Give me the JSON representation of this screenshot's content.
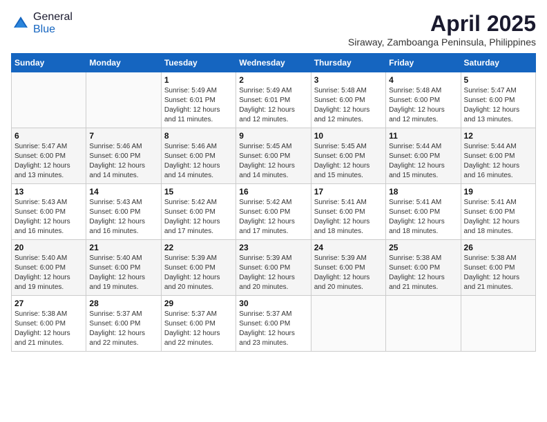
{
  "header": {
    "logo_general": "General",
    "logo_blue": "Blue",
    "title": "April 2025",
    "subtitle": "Siraway, Zamboanga Peninsula, Philippines"
  },
  "calendar": {
    "columns": [
      "Sunday",
      "Monday",
      "Tuesday",
      "Wednesday",
      "Thursday",
      "Friday",
      "Saturday"
    ],
    "weeks": [
      [
        {
          "day": "",
          "info": ""
        },
        {
          "day": "",
          "info": ""
        },
        {
          "day": "1",
          "info": "Sunrise: 5:49 AM\nSunset: 6:01 PM\nDaylight: 12 hours and 11 minutes."
        },
        {
          "day": "2",
          "info": "Sunrise: 5:49 AM\nSunset: 6:01 PM\nDaylight: 12 hours and 12 minutes."
        },
        {
          "day": "3",
          "info": "Sunrise: 5:48 AM\nSunset: 6:00 PM\nDaylight: 12 hours and 12 minutes."
        },
        {
          "day": "4",
          "info": "Sunrise: 5:48 AM\nSunset: 6:00 PM\nDaylight: 12 hours and 12 minutes."
        },
        {
          "day": "5",
          "info": "Sunrise: 5:47 AM\nSunset: 6:00 PM\nDaylight: 12 hours and 13 minutes."
        }
      ],
      [
        {
          "day": "6",
          "info": "Sunrise: 5:47 AM\nSunset: 6:00 PM\nDaylight: 12 hours and 13 minutes."
        },
        {
          "day": "7",
          "info": "Sunrise: 5:46 AM\nSunset: 6:00 PM\nDaylight: 12 hours and 14 minutes."
        },
        {
          "day": "8",
          "info": "Sunrise: 5:46 AM\nSunset: 6:00 PM\nDaylight: 12 hours and 14 minutes."
        },
        {
          "day": "9",
          "info": "Sunrise: 5:45 AM\nSunset: 6:00 PM\nDaylight: 12 hours and 14 minutes."
        },
        {
          "day": "10",
          "info": "Sunrise: 5:45 AM\nSunset: 6:00 PM\nDaylight: 12 hours and 15 minutes."
        },
        {
          "day": "11",
          "info": "Sunrise: 5:44 AM\nSunset: 6:00 PM\nDaylight: 12 hours and 15 minutes."
        },
        {
          "day": "12",
          "info": "Sunrise: 5:44 AM\nSunset: 6:00 PM\nDaylight: 12 hours and 16 minutes."
        }
      ],
      [
        {
          "day": "13",
          "info": "Sunrise: 5:43 AM\nSunset: 6:00 PM\nDaylight: 12 hours and 16 minutes."
        },
        {
          "day": "14",
          "info": "Sunrise: 5:43 AM\nSunset: 6:00 PM\nDaylight: 12 hours and 16 minutes."
        },
        {
          "day": "15",
          "info": "Sunrise: 5:42 AM\nSunset: 6:00 PM\nDaylight: 12 hours and 17 minutes."
        },
        {
          "day": "16",
          "info": "Sunrise: 5:42 AM\nSunset: 6:00 PM\nDaylight: 12 hours and 17 minutes."
        },
        {
          "day": "17",
          "info": "Sunrise: 5:41 AM\nSunset: 6:00 PM\nDaylight: 12 hours and 18 minutes."
        },
        {
          "day": "18",
          "info": "Sunrise: 5:41 AM\nSunset: 6:00 PM\nDaylight: 12 hours and 18 minutes."
        },
        {
          "day": "19",
          "info": "Sunrise: 5:41 AM\nSunset: 6:00 PM\nDaylight: 12 hours and 18 minutes."
        }
      ],
      [
        {
          "day": "20",
          "info": "Sunrise: 5:40 AM\nSunset: 6:00 PM\nDaylight: 12 hours and 19 minutes."
        },
        {
          "day": "21",
          "info": "Sunrise: 5:40 AM\nSunset: 6:00 PM\nDaylight: 12 hours and 19 minutes."
        },
        {
          "day": "22",
          "info": "Sunrise: 5:39 AM\nSunset: 6:00 PM\nDaylight: 12 hours and 20 minutes."
        },
        {
          "day": "23",
          "info": "Sunrise: 5:39 AM\nSunset: 6:00 PM\nDaylight: 12 hours and 20 minutes."
        },
        {
          "day": "24",
          "info": "Sunrise: 5:39 AM\nSunset: 6:00 PM\nDaylight: 12 hours and 20 minutes."
        },
        {
          "day": "25",
          "info": "Sunrise: 5:38 AM\nSunset: 6:00 PM\nDaylight: 12 hours and 21 minutes."
        },
        {
          "day": "26",
          "info": "Sunrise: 5:38 AM\nSunset: 6:00 PM\nDaylight: 12 hours and 21 minutes."
        }
      ],
      [
        {
          "day": "27",
          "info": "Sunrise: 5:38 AM\nSunset: 6:00 PM\nDaylight: 12 hours and 21 minutes."
        },
        {
          "day": "28",
          "info": "Sunrise: 5:37 AM\nSunset: 6:00 PM\nDaylight: 12 hours and 22 minutes."
        },
        {
          "day": "29",
          "info": "Sunrise: 5:37 AM\nSunset: 6:00 PM\nDaylight: 12 hours and 22 minutes."
        },
        {
          "day": "30",
          "info": "Sunrise: 5:37 AM\nSunset: 6:00 PM\nDaylight: 12 hours and 23 minutes."
        },
        {
          "day": "",
          "info": ""
        },
        {
          "day": "",
          "info": ""
        },
        {
          "day": "",
          "info": ""
        }
      ]
    ]
  }
}
